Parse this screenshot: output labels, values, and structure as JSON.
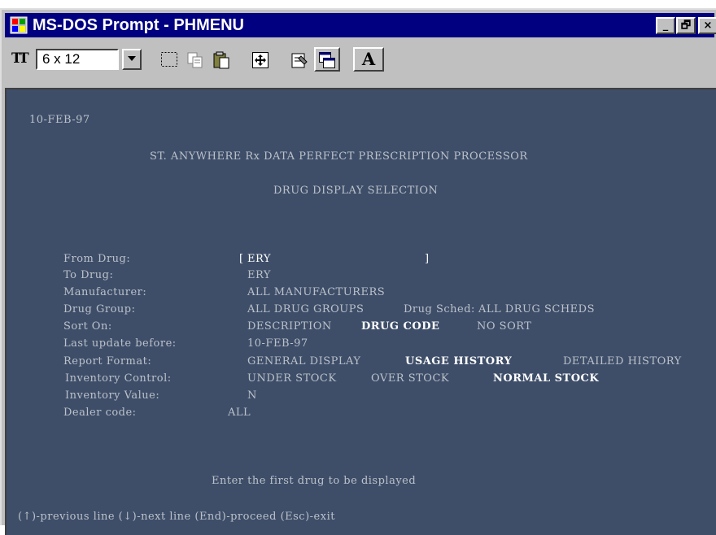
{
  "window": {
    "title": "MS-DOS Prompt - PHMENU"
  },
  "titlebar_buttons": {
    "minimize": "_",
    "maximize": "🗗",
    "close": "×"
  },
  "toolbar": {
    "font_size": "6 x 12",
    "icons": [
      "font-icon",
      "mark-icon",
      "copy-icon",
      "paste-icon",
      "fullscreen-icon",
      "properties-icon",
      "background-icon",
      "font-settings-icon"
    ],
    "font_button_glyph": "A"
  },
  "console": {
    "date": "10-FEB-97",
    "heading": "ST. ANYWHERE Rx DATA PERFECT PRESCRIPTION PROCESSOR",
    "subheading": "DRUG DISPLAY SELECTION",
    "fields": {
      "from_drug": {
        "label": "From Drug:",
        "open": "[",
        "value": "ERY",
        "close": "]"
      },
      "to_drug": {
        "label": "To Drug:",
        "value": "ERY"
      },
      "manufacturer": {
        "label": "Manufacturer:",
        "value": "ALL MANUFACTURERS"
      },
      "drug_group": {
        "label": "Drug Group:",
        "value": "ALL DRUG GROUPS",
        "sched_label": "Drug Sched:",
        "sched_value": "ALL DRUG SCHEDS"
      },
      "sort_on": {
        "label": "Sort On:",
        "options": [
          "DESCRIPTION",
          "DRUG CODE",
          "NO SORT"
        ],
        "selected": "DRUG CODE"
      },
      "last_update": {
        "label": "Last update before:",
        "value": "10-FEB-97"
      },
      "report_format": {
        "label": "Report Format:",
        "options": [
          "GENERAL DISPLAY",
          "USAGE HISTORY",
          "DETAILED HISTORY"
        ],
        "selected": "USAGE HISTORY"
      },
      "inventory_control": {
        "label": "Inventory Control:",
        "options": [
          "UNDER STOCK",
          "OVER STOCK",
          "NORMAL STOCK"
        ],
        "selected": "NORMAL STOCK"
      },
      "inventory_value": {
        "label": "Inventory Value:",
        "value": "N"
      },
      "dealer_code": {
        "label": "Dealer code:",
        "value": "ALL"
      }
    },
    "prompt": "Enter the first drug to be displayed",
    "help": "(↑)-previous line (↓)-next line (End)-proceed (Esc)-exit"
  }
}
